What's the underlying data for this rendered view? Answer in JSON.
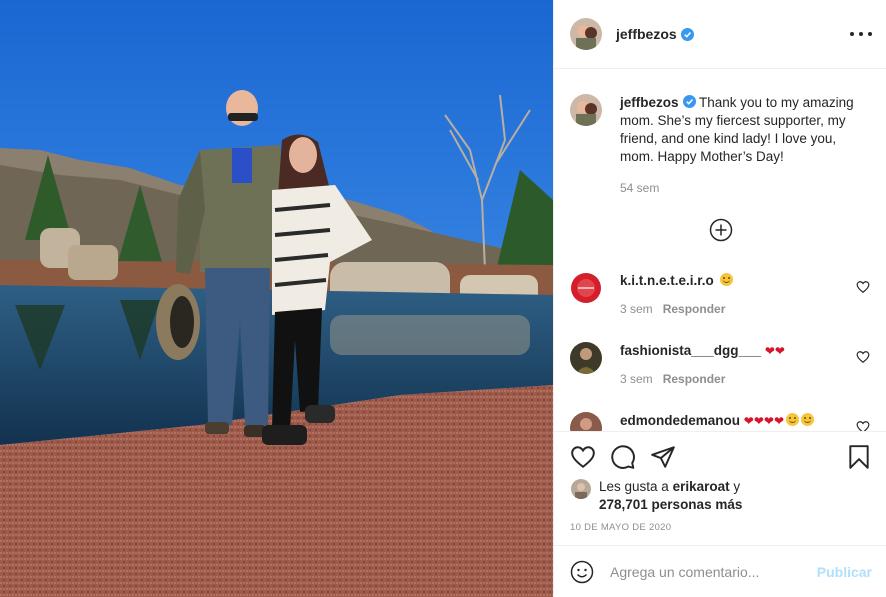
{
  "post": {
    "username": "jeffbezos",
    "verified": true,
    "photo_alt": "",
    "caption": {
      "text_lines": [
        "Thank you to my amazing",
        "mom. She’s my fiercest supporter, my",
        "friend, and one kind lady! I love you,",
        "mom. Happy Mother’s Day!"
      ],
      "time": "54 sem"
    },
    "comments": [
      {
        "username": "k.i.t.n.e.t.e.i.r.o",
        "text": "",
        "emoji": "smile",
        "time": "3 sem",
        "reply_label": "Responder"
      },
      {
        "username": "fashionista___dgg___",
        "text": "❤❤",
        "emoji": "",
        "time": "3 sem",
        "reply_label": "Responder"
      },
      {
        "username": "edmondedemanou",
        "text": "❤❤❤❤",
        "emoji": "smile2",
        "time": "",
        "reply_label": ""
      }
    ],
    "likes": {
      "prefix": "Les gusta a ",
      "user": "erikaroat",
      "suffix": " y",
      "count_text": "278,701 personas más"
    },
    "date": "10 DE MAYO DE 2020",
    "comment_box": {
      "placeholder": "Agrega un comentario...",
      "publish_label": "Publicar"
    }
  },
  "colors": {
    "verified_blue": "#3897f0",
    "publish_disabled": "#b2dffc",
    "muted_text": "#8e8e8e"
  },
  "icons": [
    "verified-icon",
    "more-icon",
    "plus-circle-icon",
    "heart-icon",
    "comment-icon",
    "share-icon",
    "bookmark-icon",
    "emoji-icon"
  ]
}
